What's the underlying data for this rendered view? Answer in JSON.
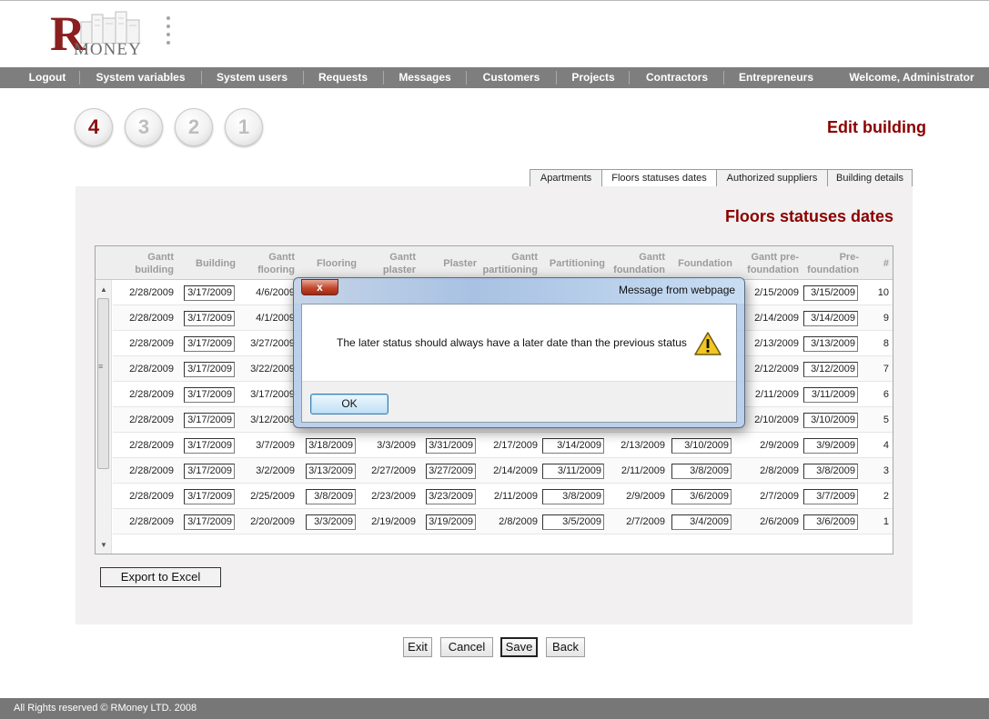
{
  "brand": {
    "letter": "R",
    "name": "MONEY"
  },
  "nav": [
    {
      "label": "Logout"
    },
    {
      "label": "System variables"
    },
    {
      "label": "System users"
    },
    {
      "label": "Requests"
    },
    {
      "label": "Messages"
    },
    {
      "label": "Customers"
    },
    {
      "label": "Projects"
    },
    {
      "label": "Contractors"
    },
    {
      "label": "Entrepreneurs"
    }
  ],
  "welcome": "Welcome, Administrator",
  "steps": [
    "4",
    "3",
    "2",
    "1"
  ],
  "page_title": "Edit building",
  "tabs": [
    {
      "label": "Apartments"
    },
    {
      "label": "Floors statuses dates"
    },
    {
      "label": "Authorized suppliers"
    },
    {
      "label": "Building details"
    }
  ],
  "panel_title": "Floors statuses dates",
  "columns": [
    {
      "label": "Gantt building"
    },
    {
      "label": "Building"
    },
    {
      "label": "Gantt flooring"
    },
    {
      "label": "Flooring"
    },
    {
      "label": "Gantt plaster"
    },
    {
      "label": "Plaster"
    },
    {
      "label": "Gantt partitioning"
    },
    {
      "label": "Partitioning"
    },
    {
      "label": "Gantt foundation"
    },
    {
      "label": "Foundation"
    },
    {
      "label": "Gantt pre-foundation"
    },
    {
      "label": "Pre-foundation"
    },
    {
      "label": "#"
    }
  ],
  "rows": [
    [
      "2/28/2009",
      "3/17/2009",
      "4/6/2009",
      "",
      "",
      "",
      "",
      "",
      "",
      "",
      "2/15/2009",
      "3/15/2009",
      "10"
    ],
    [
      "2/28/2009",
      "3/17/2009",
      "4/1/2009",
      "",
      "",
      "",
      "",
      "",
      "",
      "",
      "2/14/2009",
      "3/14/2009",
      "9"
    ],
    [
      "2/28/2009",
      "3/17/2009",
      "3/27/2009",
      "",
      "",
      "",
      "",
      "",
      "",
      "",
      "2/13/2009",
      "3/13/2009",
      "8"
    ],
    [
      "2/28/2009",
      "3/17/2009",
      "3/22/2009",
      "",
      "",
      "",
      "",
      "",
      "",
      "",
      "2/12/2009",
      "3/12/2009",
      "7"
    ],
    [
      "2/28/2009",
      "3/17/2009",
      "3/17/2009",
      "",
      "",
      "",
      "",
      "",
      "",
      "",
      "2/11/2009",
      "3/11/2009",
      "6"
    ],
    [
      "2/28/2009",
      "3/17/2009",
      "3/12/2009",
      "",
      "",
      "",
      "",
      "",
      "",
      "",
      "2/10/2009",
      "3/10/2009",
      "5"
    ],
    [
      "2/28/2009",
      "3/17/2009",
      "3/7/2009",
      "3/18/2009",
      "3/3/2009",
      "3/31/2009",
      "2/17/2009",
      "3/14/2009",
      "2/13/2009",
      "3/10/2009",
      "2/9/2009",
      "3/9/2009",
      "4"
    ],
    [
      "2/28/2009",
      "3/17/2009",
      "3/2/2009",
      "3/13/2009",
      "2/27/2009",
      "3/27/2009",
      "2/14/2009",
      "3/11/2009",
      "2/11/2009",
      "3/8/2009",
      "2/8/2009",
      "3/8/2009",
      "3"
    ],
    [
      "2/28/2009",
      "3/17/2009",
      "2/25/2009",
      "3/8/2009",
      "2/23/2009",
      "3/23/2009",
      "2/11/2009",
      "3/8/2009",
      "2/9/2009",
      "3/6/2009",
      "2/7/2009",
      "3/7/2009",
      "2"
    ],
    [
      "2/28/2009",
      "3/17/2009",
      "2/20/2009",
      "3/3/2009",
      "2/19/2009",
      "3/19/2009",
      "2/8/2009",
      "3/5/2009",
      "2/7/2009",
      "3/4/2009",
      "2/6/2009",
      "3/6/2009",
      "1"
    ]
  ],
  "export_label": "Export to Excel",
  "buttons": [
    {
      "label": "Exit"
    },
    {
      "label": "Cancel"
    },
    {
      "label": "Save"
    },
    {
      "label": "Back"
    }
  ],
  "footer": "All Rights reserved © RMoney LTD. 2008",
  "dialog": {
    "title": "Message from webpage",
    "close_glyph": "x",
    "message": "The later status should always have a later date than the previous status",
    "ok": "OK",
    "icon": "warning-icon"
  },
  "colors": {
    "accent": "#8b0000",
    "nav_bg": "#7e7e7e",
    "footer_bg": "#777777",
    "panel_bg": "#f2f0f0"
  }
}
